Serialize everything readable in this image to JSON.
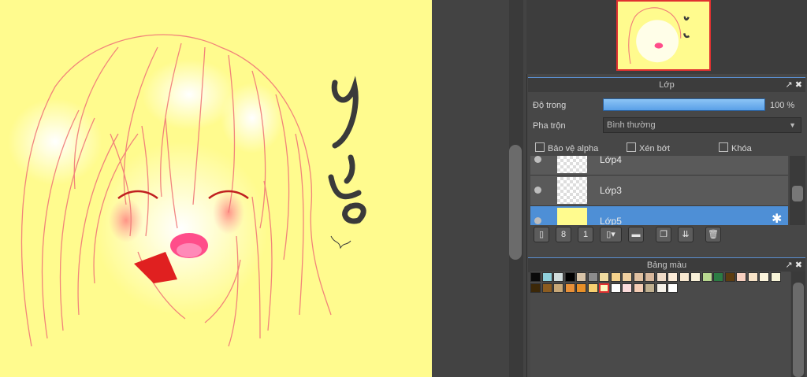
{
  "canvas": {
    "background": "#fffb8e",
    "signature_text": "yiue"
  },
  "navigator": {
    "frame_color": "#e03030"
  },
  "layer_panel": {
    "title": "Lớp",
    "opacity_label": "Độ trong",
    "opacity_value": "100 %",
    "opacity_fraction": 1.0,
    "blend_label": "Pha trộn",
    "blend_value": "Bình thường",
    "checkboxes": {
      "protect_alpha": "Bảo vệ alpha",
      "clipping": "Xén bớt",
      "lock": "Khóa"
    },
    "layers": [
      {
        "name": "Lớp4",
        "selected": false
      },
      {
        "name": "Lớp3",
        "selected": false
      },
      {
        "name": "Lớp5",
        "selected": true
      }
    ],
    "tool_icons": [
      "new-layer-icon",
      "new-layer-8bit-icon",
      "new-layer-1bit-icon",
      "add-layer-menu-icon",
      "folder-icon",
      "duplicate-layer-icon",
      "merge-layer-icon",
      "delete-layer-icon"
    ]
  },
  "palette_panel": {
    "title": "Bảng màu",
    "colors": [
      "#0a0a0a",
      "#8fd0dc",
      "#d0dcdc",
      "#000000",
      "#d8c4a8",
      "#8c8c8c",
      "#f0dca0",
      "#f5d28c",
      "#f0d0a0",
      "#e0c0a0",
      "#d8b89c",
      "#f0dcc8",
      "#fcecd8",
      "#f8e8d0",
      "#f8f0d8",
      "#b8d890",
      "#2c7c44",
      "#5c3c10",
      "#f8d0c0",
      "#f8e4c8",
      "#fcf4dc",
      "#f8f4d8",
      "#3c2808",
      "#8c5c20",
      "#c8a878",
      "#e89038",
      "#e89028",
      "#f8d070",
      "#fcf8c0",
      "#ffffff",
      "#fcdcdc",
      "#f4ccb4",
      "#c0b090",
      "#f4f0e8",
      "#ffffff"
    ],
    "selected_index": 28
  },
  "window_buttons": {
    "popout": "↗",
    "close": "✖"
  }
}
